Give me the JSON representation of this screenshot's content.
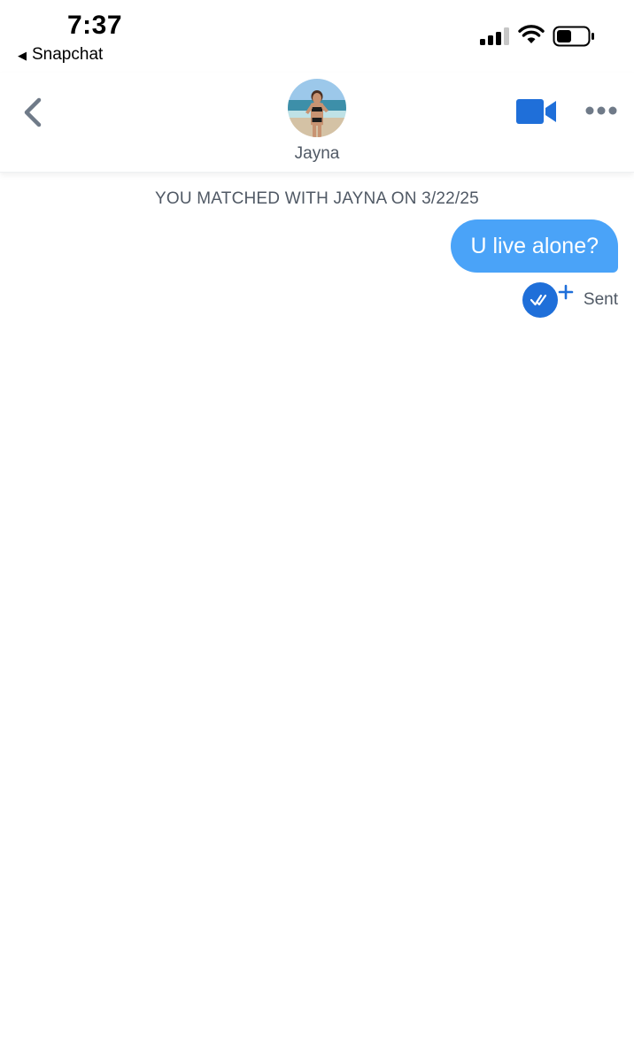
{
  "status_bar": {
    "time": "7:37",
    "back_app_label": "Snapchat",
    "back_app_icon": "left-triangle",
    "signal_icon": "cellular-signal",
    "wifi_icon": "wifi",
    "battery_icon": "battery",
    "battery_level": 0.5
  },
  "header": {
    "back_icon": "chevron-left",
    "contact_name": "Jayna",
    "avatar": "profile-photo",
    "video_icon": "video-camera",
    "more_icon": "more-dots"
  },
  "chat": {
    "match_banner": "YOU MATCHED WITH JAYNA ON 3/22/25",
    "messages": [
      {
        "from": "me",
        "text": "U live alone?",
        "status": "Sent"
      }
    ],
    "receipt_icon": "double-check-plus"
  },
  "colors": {
    "accent_blue": "#1f6fd9",
    "bubble_blue": "#4aa3f8",
    "muted_text": "#505965",
    "icon_gray": "#6f7a88"
  }
}
